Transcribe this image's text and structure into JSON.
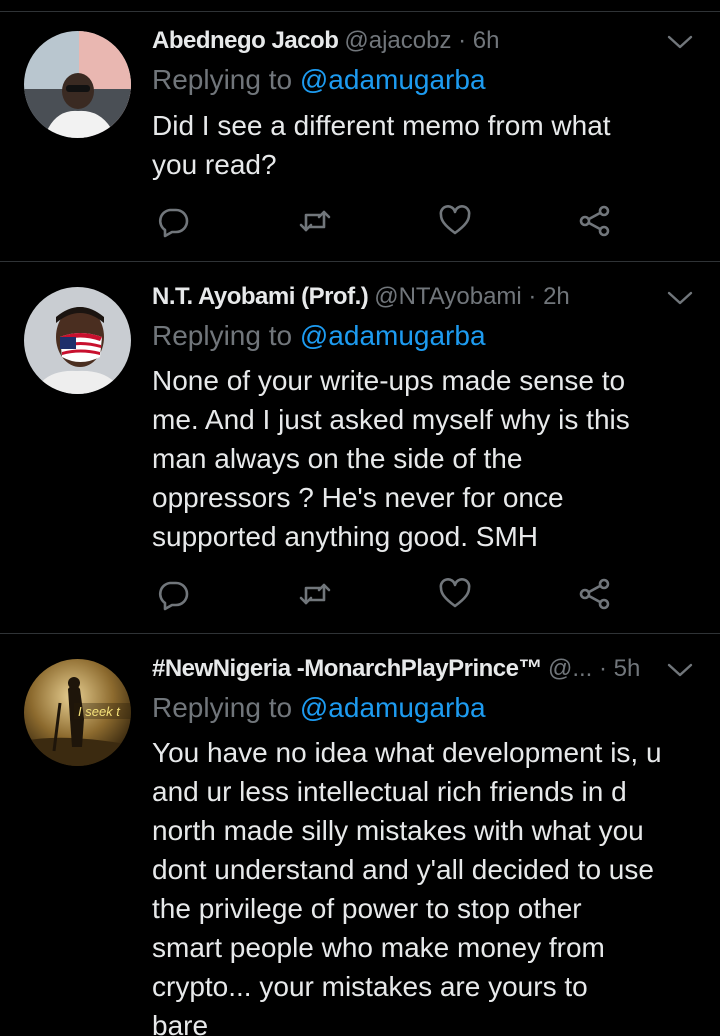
{
  "tweets": [
    {
      "name": "Abednego Jacob",
      "handle": "@ajacobz · 6h",
      "replying_label": "Replying to",
      "replying_to": "@adamugarba",
      "lines": [
        "Did I see a different memo from what",
        "you read?"
      ]
    },
    {
      "name": "N.T. Ayobami (Prof.)",
      "handle": "@NTAyobami · 2h",
      "replying_label": "Replying to",
      "replying_to": "@adamugarba",
      "lines": [
        "None of your write-ups made sense to",
        "me. And I just asked myself why is this",
        "man always on the side of the",
        "oppressors ? He's never for once",
        "supported anything good. SMH"
      ]
    },
    {
      "name": "#NewNigeria -MonarchPlayPrince™",
      "handle": "@... · 5h",
      "replying_label": "Replying to",
      "replying_to": "@adamugarba",
      "avatar_caption": "I seek t",
      "lines": [
        "You have no idea what development is, u",
        "and ur less intellectual rich friends in d",
        "north made silly mistakes with what you",
        "dont understand and y'all decided to use",
        "the privilege of power to stop other",
        "smart people who make money from",
        "crypto... your mistakes are yours to",
        "bare"
      ]
    }
  ],
  "icons": [
    "reply-icon",
    "retweet-icon",
    "like-icon",
    "share-icon",
    "chevron-down-icon"
  ],
  "colors": {
    "background": "#000000",
    "text": "#e7e9ea",
    "secondary": "#71767b",
    "link": "#1d9bf0",
    "divider": "#2f3336"
  }
}
